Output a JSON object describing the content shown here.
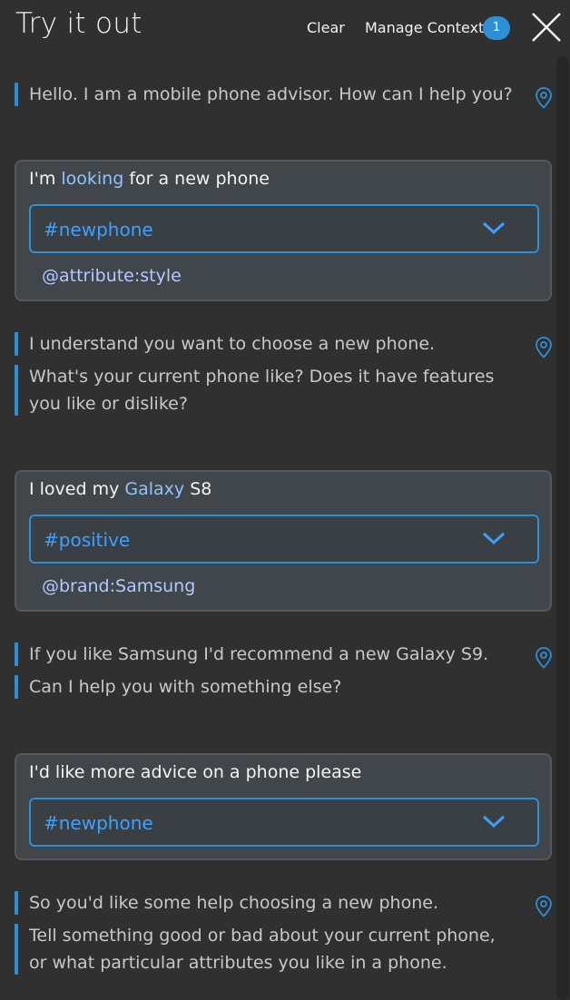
{
  "header": {
    "title": "Try it out",
    "clear_label": "Clear",
    "context_label": "Manage Context",
    "context_count": "1"
  },
  "icons": {
    "close": "close-icon",
    "location": "location-pin-icon",
    "chevron": "chevron-down-icon"
  },
  "colors": {
    "background": "#303030",
    "accent": "#2d8fd6",
    "intent_text": "#3da1ff",
    "highlight_text": "#8fc4ff",
    "card_background": "#41464b"
  },
  "conversation": {
    "bot1": {
      "lines": [
        "Hello. I am a mobile phone advisor. How can I help you?"
      ]
    },
    "user1": {
      "before": "I'm ",
      "highlight": "looking",
      "after": " for a new phone",
      "intent": "#newphone",
      "entity": "@attribute:style"
    },
    "bot2": {
      "lines": [
        "I understand you want to choose a new phone.",
        "What's your current phone like? Does it have features you like or dislike?"
      ]
    },
    "user2": {
      "before": "I loved my ",
      "highlight": "Galaxy",
      "after": " S8",
      "intent": "#positive",
      "entity": "@brand:Samsung"
    },
    "bot3": {
      "lines": [
        "If you like Samsung I'd recommend a new Galaxy S9.",
        "Can I help you with something else?"
      ]
    },
    "user3": {
      "text": "I'd like more advice on a phone please",
      "intent": "#newphone"
    },
    "bot4": {
      "lines": [
        "So you'd like some help choosing a new phone.",
        "Tell something good or bad about your current phone, or what particular attributes you like in a phone."
      ]
    }
  }
}
